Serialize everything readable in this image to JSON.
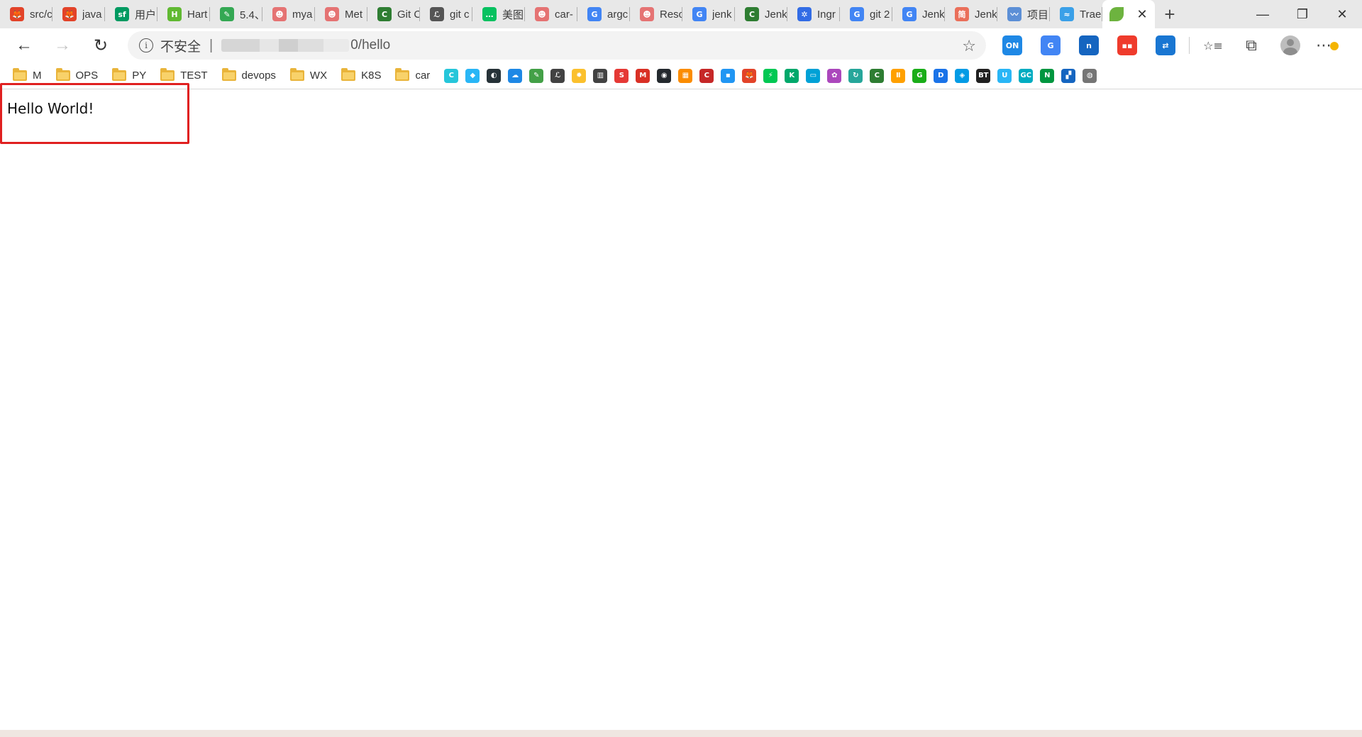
{
  "tabs": [
    {
      "label": "src/c",
      "icon": "gitlab-icon",
      "color": "#e24329",
      "glyph": "🦊"
    },
    {
      "label": "java",
      "icon": "gitlab-icon",
      "color": "#e24329",
      "glyph": "🦊"
    },
    {
      "label": "用户",
      "icon": "segmentfault-icon",
      "color": "#009a61",
      "glyph": "sf"
    },
    {
      "label": "Hart",
      "icon": "harbor-icon",
      "color": "#60b932",
      "glyph": "H"
    },
    {
      "label": "5.4、",
      "icon": "leaf-icon",
      "color": "#34a853",
      "glyph": "✎"
    },
    {
      "label": "mya",
      "icon": "octopus-icon",
      "color": "#e57373",
      "glyph": "☻"
    },
    {
      "label": "Met",
      "icon": "octopus-icon",
      "color": "#e57373",
      "glyph": "☻"
    },
    {
      "label": "Git C",
      "icon": "c-green-icon",
      "color": "#2e7d32",
      "glyph": "C"
    },
    {
      "label": "git c",
      "icon": "yuque-icon",
      "color": "#555555",
      "glyph": "ℒ"
    },
    {
      "label": "美图",
      "icon": "wechat-icon",
      "color": "#07c160",
      "glyph": "…"
    },
    {
      "label": "car-",
      "icon": "octopus-icon",
      "color": "#e57373",
      "glyph": "☻"
    },
    {
      "label": "argc",
      "icon": "google-icon",
      "color": "#4285f4",
      "glyph": "G"
    },
    {
      "label": "Resc",
      "icon": "octopus-icon",
      "color": "#e57373",
      "glyph": "☻"
    },
    {
      "label": "jenk",
      "icon": "google-icon",
      "color": "#4285f4",
      "glyph": "G"
    },
    {
      "label": "Jenk",
      "icon": "c-green-icon",
      "color": "#2e7d32",
      "glyph": "C"
    },
    {
      "label": "Ingr",
      "icon": "kubernetes-icon",
      "color": "#326ce5",
      "glyph": "✲"
    },
    {
      "label": "git 2",
      "icon": "google-icon",
      "color": "#4285f4",
      "glyph": "G"
    },
    {
      "label": "Jenk",
      "icon": "google-icon",
      "color": "#4285f4",
      "glyph": "G"
    },
    {
      "label": "Jenk",
      "icon": "jianshu-icon",
      "color": "#ea6f5a",
      "glyph": "简"
    },
    {
      "label": "项目",
      "icon": "feather-icon",
      "color": "#5c8fd6",
      "glyph": "〰"
    },
    {
      "label": "Trae",
      "icon": "trae-icon",
      "color": "#3aa0e8",
      "glyph": "≈"
    }
  ],
  "active_tab": {
    "icon": "spring-leaf-icon",
    "color": "#6db33f",
    "close_glyph": "✕"
  },
  "new_tab_glyph": "+",
  "window_controls": {
    "minimize": "—",
    "restore": "❐",
    "close": "✕"
  },
  "toolbar": {
    "back_glyph": "←",
    "forward_glyph": "→",
    "reload_glyph": "↻",
    "security_glyph": "i",
    "security_label": "不安全",
    "separator": "|",
    "url_visible": "0/hello",
    "star_glyph": "☆"
  },
  "extensions": [
    {
      "name": "on-extension-icon",
      "color": "#1e88e5",
      "glyph": "ON"
    },
    {
      "name": "translate-icon",
      "color": "#4285f4",
      "glyph": "G"
    },
    {
      "name": "n-blue-extension-icon",
      "color": "#1565c0",
      "glyph": "n"
    },
    {
      "name": "red-extension-icon",
      "color": "#ef3b2c",
      "glyph": "▪▪"
    },
    {
      "name": "sync-tabs-icon",
      "color": "#1976d2",
      "glyph": "⇄"
    }
  ],
  "toolbar_right": {
    "favorites_glyph": "☆≡",
    "collections_glyph": "⧉",
    "menu_glyph": "⋯"
  },
  "bookmark_folders": [
    "M",
    "OPS",
    "PY",
    "TEST",
    "devops",
    "WX",
    "K8S",
    "car"
  ],
  "bookmark_icons": [
    {
      "name": "c-circle-icon",
      "color": "#26c6da",
      "glyph": "C"
    },
    {
      "name": "diamond-icon",
      "color": "#29b6f6",
      "glyph": "◆"
    },
    {
      "name": "rabbit-icon",
      "color": "#263238",
      "glyph": "◐"
    },
    {
      "name": "cloud-icon",
      "color": "#1e88e5",
      "glyph": "☁"
    },
    {
      "name": "leaf-icon",
      "color": "#43a047",
      "glyph": "✎"
    },
    {
      "name": "yuque-icon",
      "color": "#424242",
      "glyph": "ℒ"
    },
    {
      "name": "gear-icon",
      "color": "#fbc02d",
      "glyph": "✹"
    },
    {
      "name": "book-icon",
      "color": "#424242",
      "glyph": "▥"
    },
    {
      "name": "red-app-icon",
      "color": "#e53935",
      "glyph": "S"
    },
    {
      "name": "gmail-icon",
      "color": "#d93025",
      "glyph": "M"
    },
    {
      "name": "github-icon",
      "color": "#24292e",
      "glyph": "◉"
    },
    {
      "name": "orange-grid-icon",
      "color": "#fb8c00",
      "glyph": "▦"
    },
    {
      "name": "c-red-icon",
      "color": "#c62828",
      "glyph": "C"
    },
    {
      "name": "blue-square-icon",
      "color": "#2196f3",
      "glyph": "▪"
    },
    {
      "name": "gitlab-icon",
      "color": "#e24329",
      "glyph": "🦊"
    },
    {
      "name": "lightning-icon",
      "color": "#00c853",
      "glyph": "⚡"
    },
    {
      "name": "k-green-icon",
      "color": "#00a86b",
      "glyph": "K"
    },
    {
      "name": "tv-icon",
      "color": "#00a1d6",
      "glyph": "▭"
    },
    {
      "name": "color-circles-icon",
      "color": "#ab47bc",
      "glyph": "✿"
    },
    {
      "name": "refresh-green-icon",
      "color": "#26a69a",
      "glyph": "↻"
    },
    {
      "name": "c-green-icon",
      "color": "#2e7d32",
      "glyph": "C"
    },
    {
      "name": "bars-icon",
      "color": "#ffa000",
      "glyph": "Ⅱ"
    },
    {
      "name": "g-green-icon",
      "color": "#1aad19",
      "glyph": "G"
    },
    {
      "name": "d-blue-icon",
      "color": "#1a73e8",
      "glyph": "D"
    },
    {
      "name": "shield-blue-icon",
      "color": "#039be5",
      "glyph": "◈"
    },
    {
      "name": "bt-icon",
      "color": "#212121",
      "glyph": "BT"
    },
    {
      "name": "u-blue-icon",
      "color": "#29b6f6",
      "glyph": "U"
    },
    {
      "name": "gc-icon",
      "color": "#00acc1",
      "glyph": "GC"
    },
    {
      "name": "n-green-icon",
      "color": "#00963f",
      "glyph": "N"
    },
    {
      "name": "yellow-blue-icon",
      "color": "#1565c0",
      "glyph": "▞"
    },
    {
      "name": "globe-icon",
      "color": "#757575",
      "glyph": "◍"
    }
  ],
  "page": {
    "text": "Hello World!",
    "highlight_color": "#e02020"
  }
}
